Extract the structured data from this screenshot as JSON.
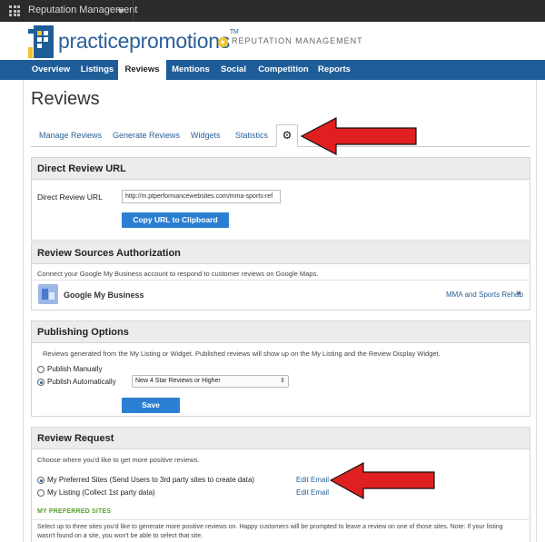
{
  "appbar": {
    "title": "Reputation Management"
  },
  "brand": {
    "name": "practicepromotions",
    "tm": "TM",
    "sub": "REPUTATION MANAGEMENT"
  },
  "nav": {
    "items": [
      "Overview",
      "Listings",
      "Reviews",
      "Mentions",
      "Social",
      "Competition",
      "Reports"
    ],
    "active": "Reviews"
  },
  "page": {
    "title": "Reviews"
  },
  "tabs": {
    "items": [
      "Manage Reviews",
      "Generate Reviews",
      "Widgets",
      "Statistics"
    ],
    "active_icon": "gear-icon"
  },
  "direct_url": {
    "heading": "Direct Review URL",
    "label": "Direct Review URL",
    "value": "http://m.ptperformancewebsites.com/mma-sports-ref",
    "button": "Copy URL to Clipboard"
  },
  "sources": {
    "heading": "Review Sources Authorization",
    "description": "Connect your Google My Business account to respond to customer reviews on Google Maps.",
    "name": "Google My Business",
    "account": "MMA and Sports Rehab",
    "remove": "×"
  },
  "publishing": {
    "heading": "Publishing Options",
    "description": "Reviews generated from the My Listing or Widget. Published reviews will show up on the My Listing and the Review Display Widget.",
    "option_manual": "Publish Manually",
    "option_auto": "Publish Automatically",
    "selected": "auto",
    "filter_value": "New 4 Star Reviews or Higher",
    "save": "Save"
  },
  "request": {
    "heading": "Review Request",
    "description": "Choose where you'd like to get more positive reviews.",
    "option_preferred": "My Preferred Sites (Send Users to 3rd party sites to create data)",
    "option_listing": "My Listing (Collect 1st party data)",
    "edit_email_1": "Edit Email",
    "edit_email_2": "Edit Email",
    "section_label": "MY PREFERRED SITES",
    "section_text_1": "Select up to three sites you'd like to generate more positive reviews on. Happy customers will be prompted to leave a review on one of those sites. Note: If your listing",
    "section_text_2": "wasn't found on a site, you won't be able to select that site."
  },
  "colors": {
    "nav": "#1f5d98",
    "link": "#2b6098",
    "button": "#2b7fd2",
    "annotation_arrow": "#e02020",
    "section_green": "#5aa02c"
  }
}
